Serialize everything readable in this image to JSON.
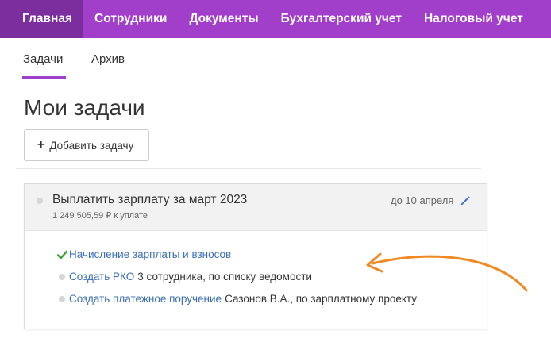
{
  "topnav": {
    "items": [
      {
        "label": "Главная",
        "active": true
      },
      {
        "label": "Сотрудники"
      },
      {
        "label": "Документы"
      },
      {
        "label": "Бухгалтерский учет"
      },
      {
        "label": "Налоговый учет"
      }
    ]
  },
  "subtabs": {
    "items": [
      {
        "label": "Задачи",
        "active": true
      },
      {
        "label": "Архив"
      }
    ]
  },
  "page": {
    "title": "Мои задачи",
    "add_button_label": "Добавить задачу"
  },
  "task": {
    "title": "Выплатить зарплату за март 2023",
    "amount": "1 249 505,59 ₽ к уплате",
    "due": "до 10 апреля",
    "subtasks": [
      {
        "link": "Начисление зарплаты и взносов",
        "desc": "",
        "status": "done"
      },
      {
        "link": "Создать РКО",
        "desc": "3 сотрудника, по списку ведомости",
        "status": "pending"
      },
      {
        "link": "Создать платежное поручение",
        "desc": "Сазонов В.А., по зарплатному проекту",
        "status": "pending"
      }
    ]
  },
  "colors": {
    "nav_bg": "#a23fca",
    "nav_active": "#7c2e9e",
    "link": "#3a6fb4",
    "check": "#3aa63a",
    "arrow": "#f08a24"
  },
  "icons": {
    "add": "plus-icon",
    "edit": "pencil-icon",
    "done": "check-icon",
    "pending": "dot-icon"
  }
}
